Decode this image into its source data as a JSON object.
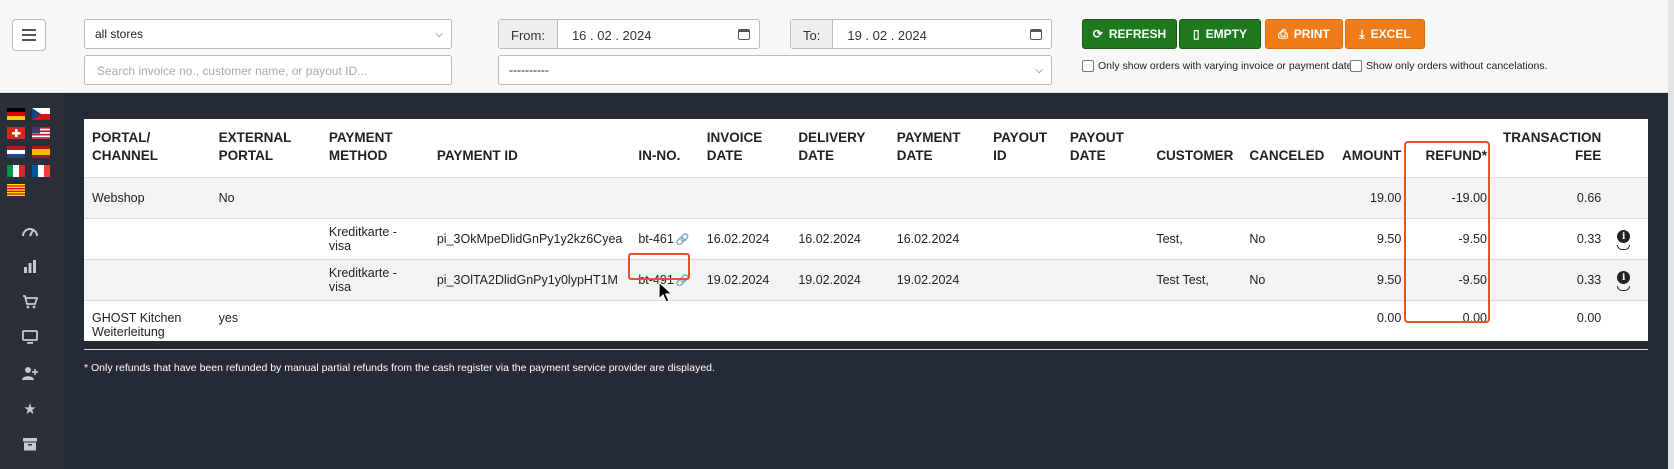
{
  "filters": {
    "store_select": "all stores",
    "search_placeholder": "Search invoice no., customer name, or payout ID...",
    "from_label": "From:",
    "from_date": "16 . 02 . 2024",
    "to_label": "To:",
    "to_date": "19 . 02 . 2024",
    "secondary_select": "----------",
    "checkbox_varying_dates": "Only show orders with varying invoice or payment dates.",
    "checkbox_no_cancel": "Show only orders without cancelations."
  },
  "buttons": {
    "refresh": "REFRESH",
    "empty": "EMPTY",
    "print": "PRINT",
    "excel": "EXCEL"
  },
  "colors": {
    "green": "#1f7a1f",
    "orange": "#f07d1a",
    "highlight": "#e8522b"
  },
  "table": {
    "headers": {
      "portal": "PORTAL/ CHANNEL",
      "external": "EXTERNAL PORTAL",
      "method": "PAYMENT METHOD",
      "payment_id": "PAYMENT ID",
      "in_no": "IN-NO.",
      "invoice_date": "INVOICE DATE",
      "delivery_date": "DELIVERY DATE",
      "payment_date": "PAYMENT DATE",
      "payout_id": "PAYOUT ID",
      "payout_date": "PAYOUT DATE",
      "customer": "CUSTOMER",
      "canceled": "CANCELED",
      "amount": "AMOUNT",
      "refund": "REFUND*",
      "fee": "TRANSACTION FEE"
    },
    "rows": [
      {
        "portal": "Webshop",
        "external": "No",
        "method": "",
        "payment_id": "",
        "in_no": "",
        "invoice_date": "",
        "delivery_date": "",
        "payment_date": "",
        "payout_id": "",
        "payout_date": "",
        "customer": "",
        "canceled": "",
        "amount": "19.00",
        "refund": "-19.00",
        "fee": "0.66"
      },
      {
        "portal": "",
        "external": "",
        "method": "Kreditkarte - visa",
        "payment_id": "pi_3OkMpeDlidGnPy1y2kz6Cyea",
        "in_no": "bt-461",
        "invoice_date": "16.02.2024",
        "delivery_date": "16.02.2024",
        "payment_date": "16.02.2024",
        "payout_id": "",
        "payout_date": "",
        "customer": "Test,",
        "canceled": "No",
        "amount": "9.50",
        "refund": "-9.50",
        "fee": "0.33"
      },
      {
        "portal": "",
        "external": "",
        "method": "Kreditkarte - visa",
        "payment_id": "pi_3OlTA2DlidGnPy1y0lypHT1M",
        "in_no": "bt-491",
        "invoice_date": "19.02.2024",
        "delivery_date": "19.02.2024",
        "payment_date": "19.02.2024",
        "payout_id": "",
        "payout_date": "",
        "customer": "Test Test,",
        "canceled": "No",
        "amount": "9.50",
        "refund": "-9.50",
        "fee": "0.33"
      },
      {
        "portal": "GHOST Kitchen Weiterleitung",
        "external": "yes",
        "method": "",
        "payment_id": "",
        "in_no": "",
        "invoice_date": "",
        "delivery_date": "",
        "payment_date": "",
        "payout_id": "",
        "payout_date": "",
        "customer": "",
        "canceled": "",
        "amount": "0.00",
        "refund": "0.00",
        "fee": "0.00"
      }
    ]
  },
  "footnote": "* Only refunds that have been refunded by manual partial refunds from the cash register via the payment service provider are displayed.",
  "sidebar": {
    "flags": [
      "de",
      "cz",
      "ch",
      "us",
      "nl",
      "es",
      "it",
      "fr",
      "ct"
    ],
    "icons": [
      "dashboard-icon",
      "chart-icon",
      "cart-icon",
      "monitor-icon",
      "add-user-icon",
      "star-icon",
      "archive-icon"
    ]
  }
}
